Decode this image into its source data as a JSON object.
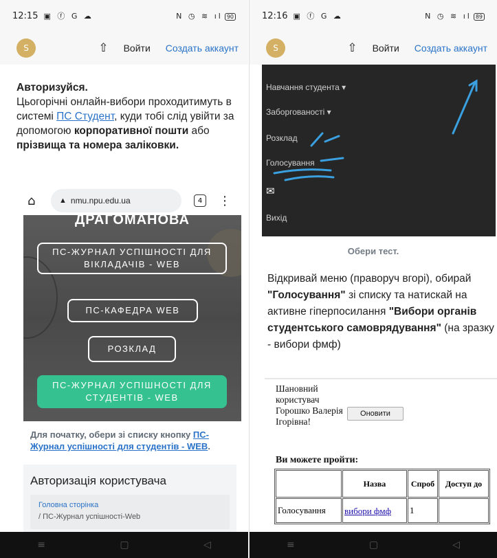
{
  "left": {
    "status": {
      "time": "12:15",
      "icons": "▣ ⓕ G ☁",
      "right_icons": "Ν ◷ ≋ ıl",
      "battery": "90"
    },
    "topbar": {
      "avatar": "S",
      "login": "Войти",
      "create": "Создать аккаунт"
    },
    "intro": {
      "heading": "Авторизуйся.",
      "line1": "Цьогорічні онлайн-вибори проходитимуть в системі ",
      "link": "ПС Студент",
      "line2": ", куди тобі слід увійти за допомогою ",
      "bold1": "корпоративної пошти",
      "line3": " або ",
      "bold2": "прізвища та номера заліковки."
    },
    "browser": {
      "url": "nmu.npu.edu.ua",
      "tabs": "4"
    },
    "hero": {
      "title": "ДРАГОМАНОВА",
      "btn_journal_teachers": "ПС-ЖУРНАЛ УСПІШНОСТІ ДЛЯ ВІКЛАДАЧІВ - WEB",
      "btn_department": "ПС-КАФЕДРА WEB",
      "btn_schedule": "РОЗКЛАД",
      "btn_journal_students": "ПС-ЖУРНАЛ УСПІШНОСТІ ДЛЯ СТУДЕНТІВ - WEB"
    },
    "caption": {
      "text": "Для початку, обери зі списку кнопку ",
      "link": "ПС-Журнал успішності для студентів - WEB",
      "end": "."
    },
    "auth": {
      "title": "Авторизація користувача",
      "crumb_home": "Головна сторінка",
      "crumb_current": "/  ПС-Журнал успішності-Web"
    }
  },
  "right": {
    "status": {
      "time": "12:16",
      "icons": "▣ ⓕ G ☁",
      "right_icons": "Ν ◷ ≋ ıl",
      "battery": "89"
    },
    "topbar": {
      "avatar": "S",
      "login": "Войти",
      "create": "Создать аккаунт"
    },
    "menu": {
      "studies": "Навчання студента ▾",
      "debts": "Заборгованості ▾",
      "schedule": "Розклад",
      "voting": "Голосування",
      "exit": "Вихід"
    },
    "caption": "Обери тест.",
    "instruction": {
      "p1": "Відкривай меню (праворуч вгорі), обирай ",
      "b1": "\"Голосування\"",
      "p2": " зі списку та натискай на активне гіперпосилання ",
      "b2": "\"Вибори органів студентського самоврядування\"",
      "p3": " (на зразку - вибори фмф)"
    },
    "vote": {
      "greeting": "Шановний користувач Горошко Валерія Ігорівна!",
      "refresh": "Оновити",
      "can_pass": "Ви можете пройти:",
      "columns": [
        "",
        "Назва",
        "Спроб",
        "Доступ до"
      ],
      "row": {
        "type": "Голосування",
        "name": "вибори фмф",
        "attempts": "1",
        "access": ""
      }
    }
  },
  "navbar": {
    "menu": "≡",
    "home": "▢",
    "back": "◁"
  },
  "colors": {
    "link": "#2a73c8",
    "green_button": "#36c191",
    "menu_bg": "#262626",
    "scribble": "#3aa0e0"
  }
}
